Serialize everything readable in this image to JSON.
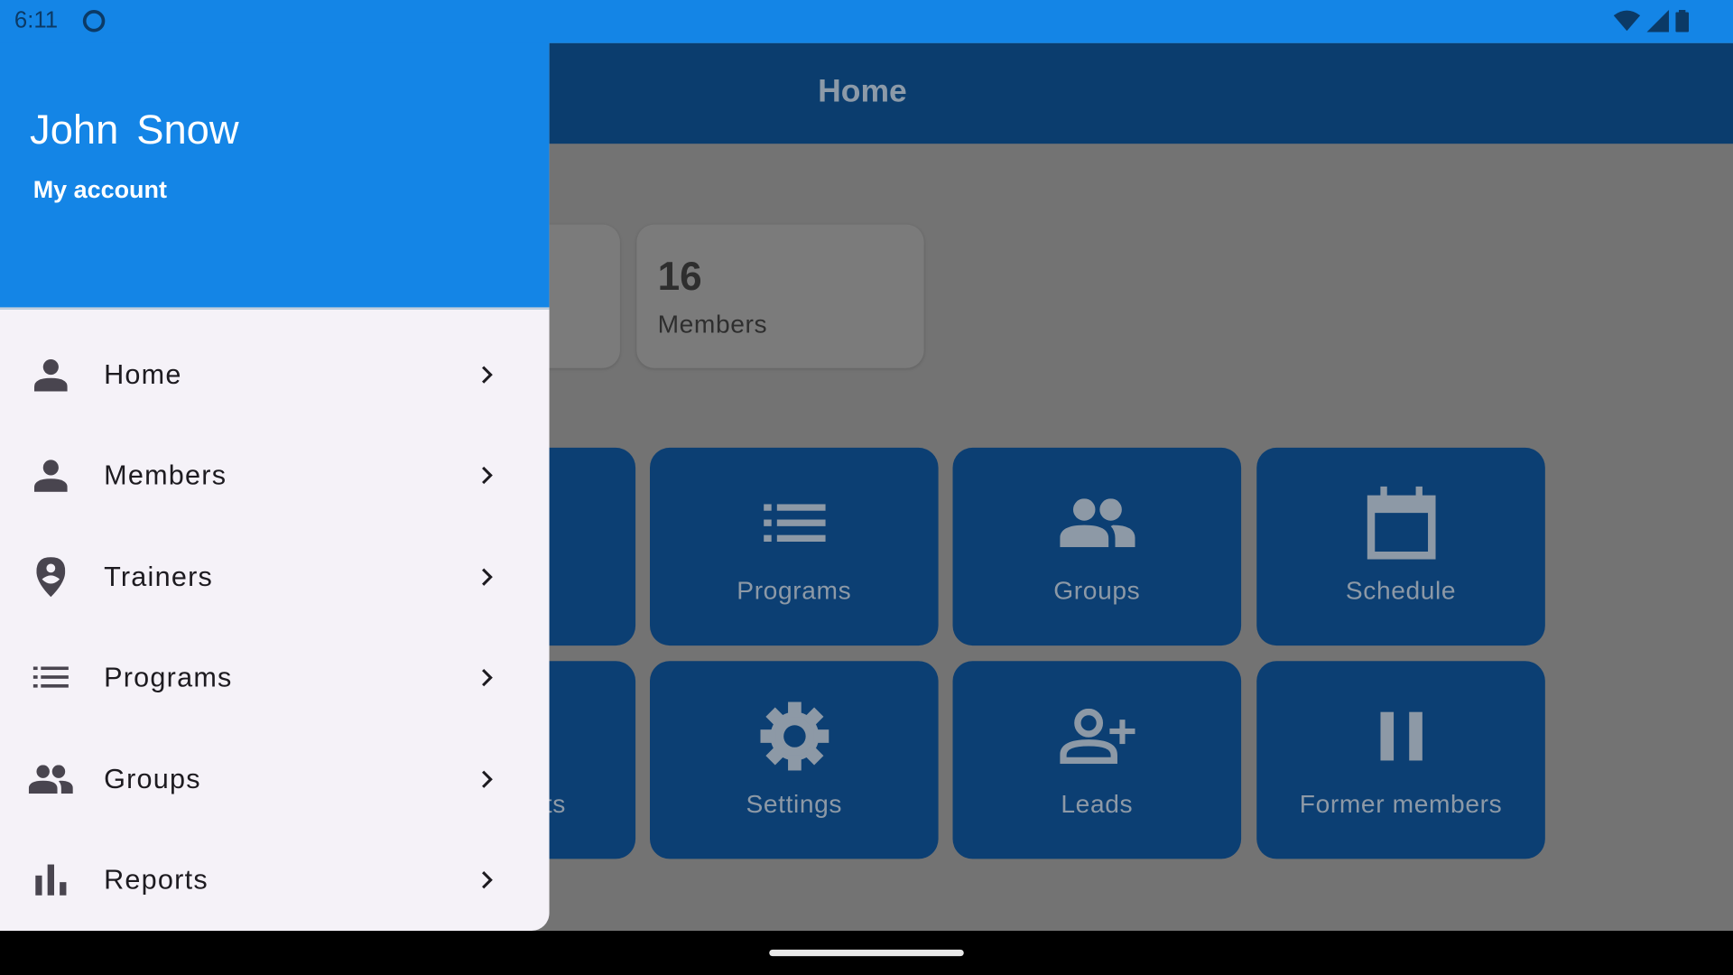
{
  "status_bar": {
    "time": "6:11"
  },
  "app_bar": {
    "title": "Home"
  },
  "stats": [
    {
      "value": "16",
      "label": "Members"
    }
  ],
  "tiles": [
    {
      "label": "",
      "icon": "hidden"
    },
    {
      "label": "Programs",
      "icon": "list-icon"
    },
    {
      "label": "Groups",
      "icon": "groups-icon"
    },
    {
      "label": "Schedule",
      "icon": "calendar-icon"
    },
    {
      "label": "ts",
      "icon": "hidden"
    },
    {
      "label": "Settings",
      "icon": "gear-icon"
    },
    {
      "label": "Leads",
      "icon": "person-add-icon"
    },
    {
      "label": "Former members",
      "icon": "pause-icon"
    }
  ],
  "drawer": {
    "user_name": "John  Snow",
    "account_link": "My account",
    "items": [
      {
        "label": "Home",
        "icon": "person-icon"
      },
      {
        "label": "Members",
        "icon": "person-icon"
      },
      {
        "label": "Trainers",
        "icon": "person-pin-icon"
      },
      {
        "label": "Programs",
        "icon": "list-icon"
      },
      {
        "label": "Groups",
        "icon": "groups-icon"
      },
      {
        "label": "Reports",
        "icon": "bar-chart-icon"
      }
    ]
  },
  "colors": {
    "primary": "#1485e6",
    "app_bar": "#0b3d6e",
    "tile": "#0c3f73",
    "drawer_bg": "#f5f2f8",
    "scrim": "#737373"
  }
}
